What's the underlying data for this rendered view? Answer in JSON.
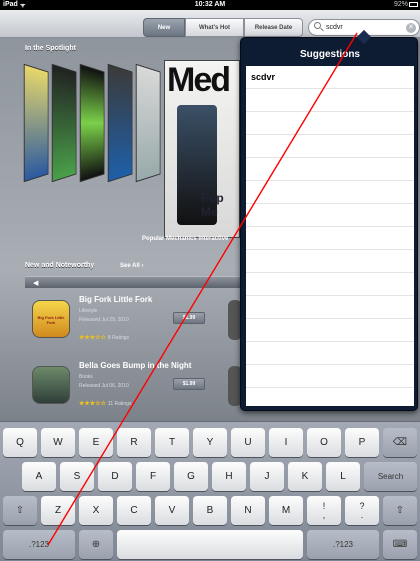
{
  "status_bar": {
    "device": "iPad",
    "time": "10:32 AM",
    "battery": "92%"
  },
  "toolbar": {
    "tabs": [
      {
        "label": "New",
        "active": true
      },
      {
        "label": "What's Hot",
        "active": false
      },
      {
        "label": "Release Date",
        "active": false
      }
    ],
    "search": {
      "value": "scdvr"
    }
  },
  "store": {
    "spotlight_title": "In the Spotlight",
    "spotlight_caption": "Popular Mechanics Interactive",
    "magazine_masthead": "Med",
    "magazine_sub": "Pop Me",
    "new_title": "New and Noteworthy",
    "see_all": "See All",
    "apps": [
      {
        "title": "Big Fork Little Fork",
        "category": "Lifestyle",
        "released": "Released Jul 29, 2010",
        "stars": "★★★☆☆",
        "ratings": "8 Ratings",
        "price": "$1.99",
        "icon_text": "Big Fork Little Fork"
      },
      {
        "title": "Bella Goes Bump in the Night",
        "category": "Books",
        "released": "Released Jul 06, 2010",
        "stars": "★★★☆☆",
        "ratings": "11 Ratings",
        "price": "$1.99"
      }
    ]
  },
  "suggestions": {
    "title": "Suggestions",
    "items": [
      "scdvr"
    ]
  },
  "keyboard": {
    "row1": [
      "Q",
      "W",
      "E",
      "R",
      "T",
      "Y",
      "U",
      "I",
      "O",
      "P"
    ],
    "row2": [
      "A",
      "S",
      "D",
      "F",
      "G",
      "H",
      "J",
      "K",
      "L"
    ],
    "row3": [
      "Z",
      "X",
      "C",
      "V",
      "B",
      "N",
      "M"
    ],
    "search_label": "Search",
    "numbers_label": ".?123",
    "punct": [
      {
        "top": "!",
        "bottom": ","
      },
      {
        "top": "?",
        "bottom": "."
      }
    ]
  },
  "colors": {
    "annotation_line": "#ff0000",
    "popover_bg": "#0d1b33"
  }
}
